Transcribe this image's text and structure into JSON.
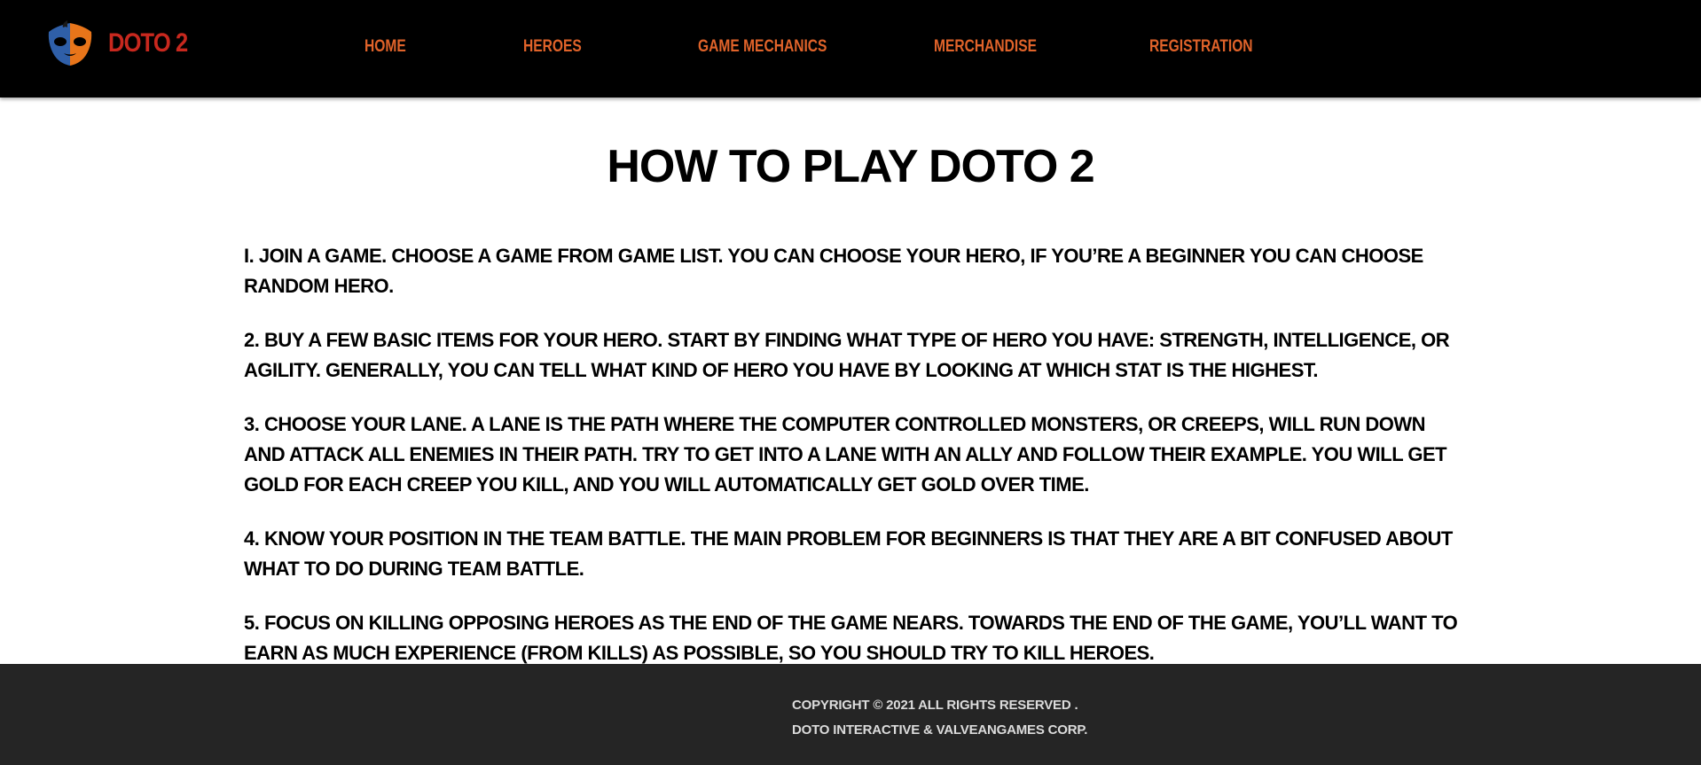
{
  "colors": {
    "nav_background": "#000000",
    "brand_red": "#c8281e",
    "nav_link_orange": "#e0632a",
    "logo_blue": "#2f5fa8",
    "logo_orange": "#e8751a",
    "footer_background": "#252525",
    "footer_text": "#dcdcdc"
  },
  "header": {
    "logo_icon": "masked-face-logo",
    "brand_name": "DOTO 2",
    "nav": [
      "HOME",
      "HEROES",
      "GAME MECHANICS",
      "MERCHANDISE",
      "REGISTRATION"
    ]
  },
  "main": {
    "title": "HOW TO PLAY DOTO 2",
    "steps": [
      "I. JOIN A GAME. CHOOSE A GAME FROM GAME LIST. YOU CAN CHOOSE YOUR HERO, IF YOU’RE A BEGINNER YOU CAN CHOOSE RANDOM HERO.",
      "2. BUY A FEW BASIC ITEMS FOR YOUR HERO. START BY FINDING WHAT TYPE OF HERO YOU HAVE: STRENGTH, INTELLIGENCE, OR AGILITY. GENERALLY, YOU CAN TELL WHAT KIND OF HERO YOU HAVE BY LOOKING AT WHICH STAT IS THE HIGHEST.",
      "3. CHOOSE YOUR LANE. A LANE IS THE PATH WHERE THE COMPUTER CONTROLLED MONSTERS, OR CREEPS, WILL RUN DOWN AND ATTACK ALL ENEMIES IN THEIR PATH. TRY TO GET INTO A LANE WITH AN ALLY AND FOLLOW THEIR EXAMPLE. YOU WILL GET GOLD FOR EACH CREEP YOU KILL, AND YOU WILL AUTOMATICALLY GET GOLD OVER TIME.",
      "4. KNOW YOUR POSITION IN THE TEAM BATTLE. THE MAIN PROBLEM FOR BEGINNERS IS THAT THEY ARE A BIT CONFUSED ABOUT WHAT TO DO DURING TEAM BATTLE.",
      "5. FOCUS ON KILLING OPPOSING HEROES AS THE END OF THE GAME NEARS. TOWARDS THE END OF THE GAME, YOU’LL WANT TO EARN AS MUCH EXPERIENCE (FROM KILLS) AS POSSIBLE, SO YOU SHOULD TRY TO KILL HEROES."
    ]
  },
  "footer": {
    "copyright": "COPYRIGHT © 2021 ALL RIGHTS RESERVED .",
    "company": "DOTO INTERACTIVE & VALVEANGAMES CORP."
  }
}
